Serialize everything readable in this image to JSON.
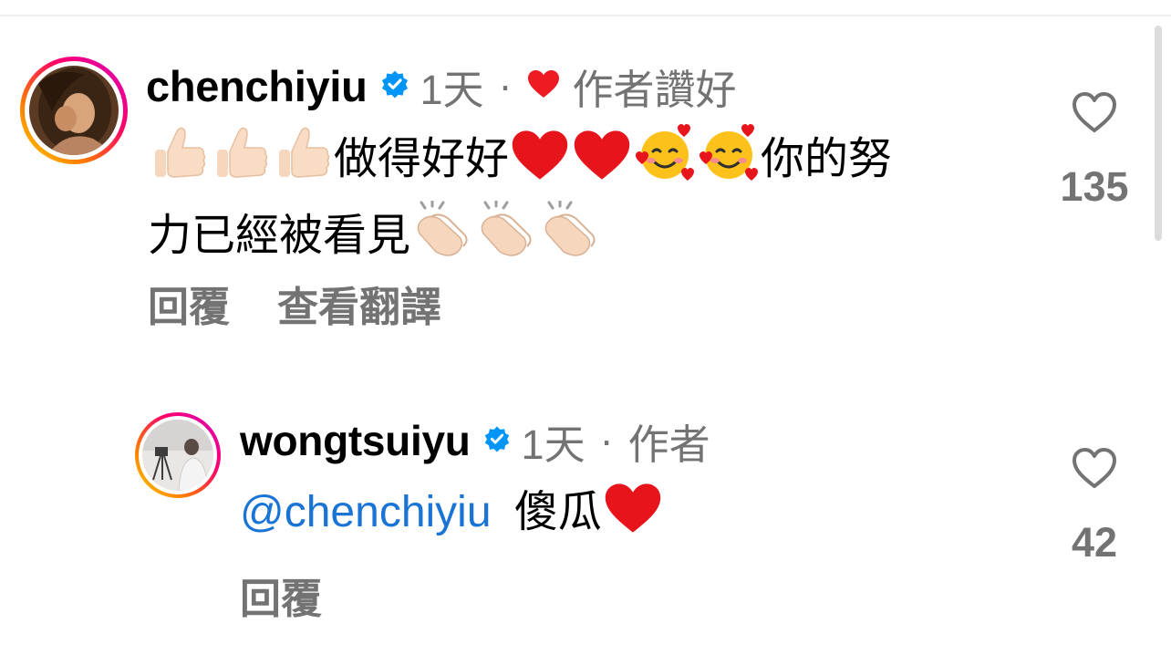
{
  "comments": [
    {
      "username": "chenchiyiu",
      "time": "1天",
      "separator": "·",
      "author_liked_label": "作者讚好",
      "text_part1": "做得好好",
      "text_part2": "你的努",
      "text_part3": "力已經被看見",
      "emojis": [
        "thumbs-up",
        "thumbs-up",
        "thumbs-up",
        "red-heart",
        "red-heart",
        "smiling-face-with-hearts",
        "smiling-face-with-hearts",
        "clapping-hands",
        "clapping-hands",
        "clapping-hands"
      ],
      "reply_label": "回覆",
      "translate_label": "查看翻譯",
      "like_count": "135"
    },
    {
      "username": "wongtsuiyu",
      "time": "1天",
      "separator": "·",
      "author_label": "作者",
      "mention": "@chenchiyiu",
      "text": "傻瓜",
      "emojis": [
        "red-heart"
      ],
      "reply_label": "回覆",
      "like_count": "42"
    }
  ],
  "colors": {
    "verified_blue": "#0095f6",
    "mention_blue": "#1a74d6",
    "muted_text": "#737373",
    "heart_red": "#ed1c24"
  }
}
